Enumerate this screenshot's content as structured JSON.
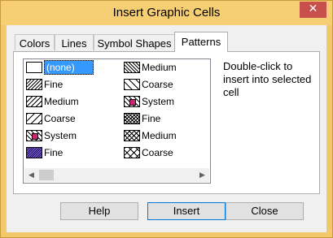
{
  "window": {
    "title": "Insert Graphic Cells",
    "close_glyph": "✕"
  },
  "tabs": [
    {
      "label": "Colors",
      "active": false
    },
    {
      "label": "Lines",
      "active": false
    },
    {
      "label": "Symbol Shapes",
      "active": false
    },
    {
      "label": "Patterns",
      "active": true
    }
  ],
  "patterns": {
    "items": [
      {
        "label": "(none)",
        "pattern": "none",
        "selected": true
      },
      {
        "label": "Fine",
        "pattern": "diagonal-fine"
      },
      {
        "label": "Medium",
        "pattern": "diagonal-medium"
      },
      {
        "label": "Coarse",
        "pattern": "diagonal-coarse"
      },
      {
        "label": "System",
        "pattern": "system-diagonal"
      },
      {
        "label": "Fine",
        "pattern": "purple-fine"
      },
      {
        "label": "Medium",
        "pattern": "reverse-diagonal-medium"
      },
      {
        "label": "Coarse",
        "pattern": "reverse-diagonal-coarse"
      },
      {
        "label": "System",
        "pattern": "system-reverse"
      },
      {
        "label": "Fine",
        "pattern": "cross-fine"
      },
      {
        "label": "Medium",
        "pattern": "cross-medium"
      },
      {
        "label": "Coarse",
        "pattern": "cross-coarse"
      }
    ]
  },
  "hint": "Double-click to insert into selected cell",
  "buttons": {
    "help": "Help",
    "insert": "Insert",
    "close": "Close"
  },
  "colors": {
    "title_bar": "#f6cf74",
    "close_button": "#c7504d",
    "selection": "#3399ff"
  }
}
